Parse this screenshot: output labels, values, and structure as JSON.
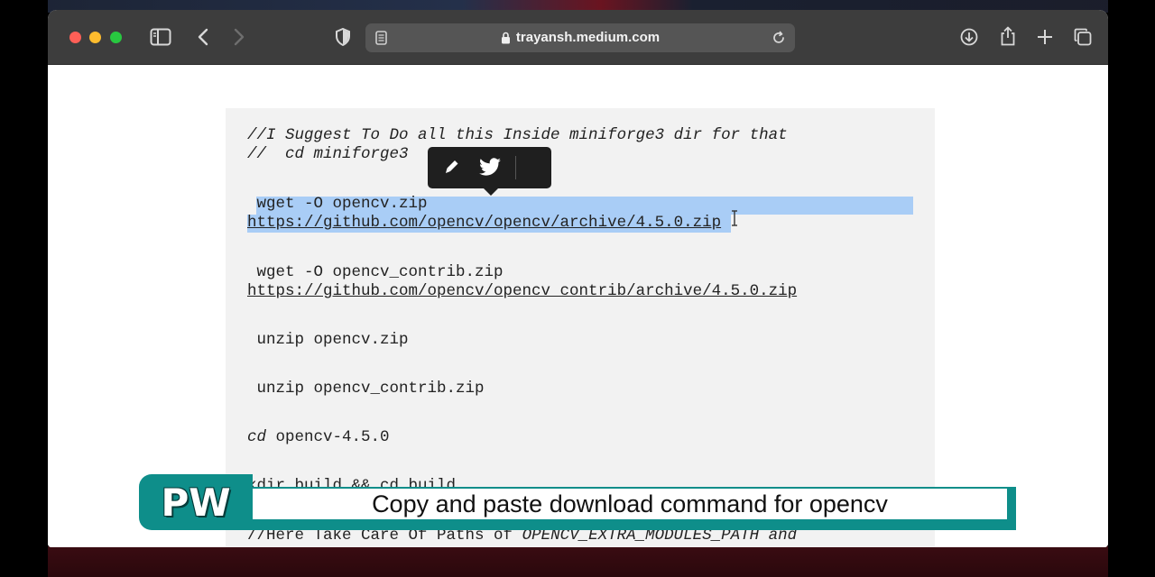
{
  "browser": {
    "url": "trayansh.medium.com",
    "icons": [
      "sidebar-icon",
      "back-icon",
      "forward-icon",
      "shield-icon",
      "reader-icon",
      "lock-icon",
      "reload-icon",
      "download-icon",
      "share-icon",
      "new-tab-icon",
      "tabs-overview-icon"
    ]
  },
  "code": {
    "lines": [
      "//I Suggest To Do all this Inside miniforge3 dir for that",
      "//  cd miniforge3",
      " wget -O opencv.zip",
      "https://github.com/opencv/opencv/archive/4.5.0.zip",
      " wget -O opencv_contrib.zip",
      "https://github.com/opencv/opencv_contrib/archive/4.5.0.zip",
      " unzip opencv.zip",
      " unzip opencv_contrib.zip",
      " opencv-4.5.0",
      "kdir build && cd build",
      "//Here Take Care Of Paths of ",
      "OPENCV_EXTRA_MODULES_PATH and"
    ],
    "cd_keyword": "cd"
  },
  "popover": {
    "icons": [
      "highlight-pen-icon",
      "twitter-icon"
    ]
  },
  "caption": {
    "logo": "PW",
    "text": "Copy and paste download command for opencv",
    "color": "#0e8e8a"
  }
}
